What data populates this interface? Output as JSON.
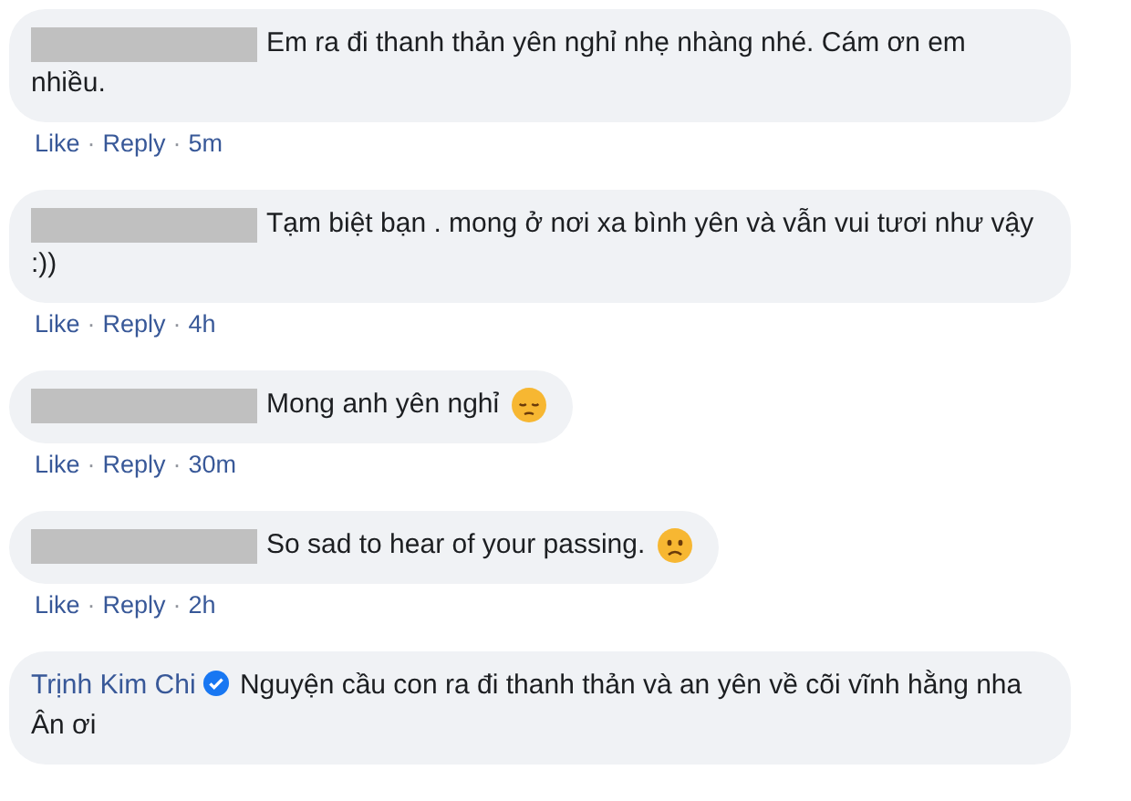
{
  "comments": [
    {
      "kind": "plain",
      "author": {
        "redacted": true
      },
      "text": "Em ra đi thanh thản yên nghỉ nhẹ nhàng nhé. Cám ơn em nhiều.",
      "meta": [
        {
          "kind": "link",
          "label": "Like"
        },
        {
          "kind": "sep",
          "label": "·"
        },
        {
          "kind": "link",
          "label": "Reply"
        },
        {
          "kind": "sep",
          "label": "·"
        },
        {
          "kind": "time",
          "label": "5m"
        }
      ]
    },
    {
      "kind": "plain",
      "author": {
        "redacted": true
      },
      "text": "Tạm biệt bạn . mong ở nơi xa bình yên và vẫn vui tươi như vậy :))",
      "meta": [
        {
          "kind": "link",
          "label": "Like"
        },
        {
          "kind": "sep",
          "label": "·"
        },
        {
          "kind": "link",
          "label": "Reply"
        },
        {
          "kind": "sep",
          "label": "·"
        },
        {
          "kind": "time",
          "label": "4h"
        }
      ]
    },
    {
      "kind": "pensive",
      "author": {
        "redacted": true
      },
      "text": "Mong anh yên nghỉ",
      "meta": [
        {
          "kind": "link",
          "label": "Like"
        },
        {
          "kind": "sep",
          "label": "·"
        },
        {
          "kind": "link",
          "label": "Reply"
        },
        {
          "kind": "sep",
          "label": "·"
        },
        {
          "kind": "time",
          "label": "30m"
        }
      ]
    },
    {
      "kind": "frown",
      "author": {
        "redacted": true
      },
      "text": "So sad to hear of your passing.",
      "meta": [
        {
          "kind": "link",
          "label": "Like"
        },
        {
          "kind": "sep",
          "label": "·"
        },
        {
          "kind": "link",
          "label": "Reply"
        },
        {
          "kind": "sep",
          "label": "·"
        },
        {
          "kind": "time",
          "label": "2h"
        }
      ]
    },
    {
      "author": {
        "redacted": false,
        "name": "Trịnh Kim Chi",
        "verified": true
      },
      "text": "Nguyện cầu con ra đi thanh thản và an yên về cõi vĩnh hằng nha Ân ơi"
    }
  ]
}
